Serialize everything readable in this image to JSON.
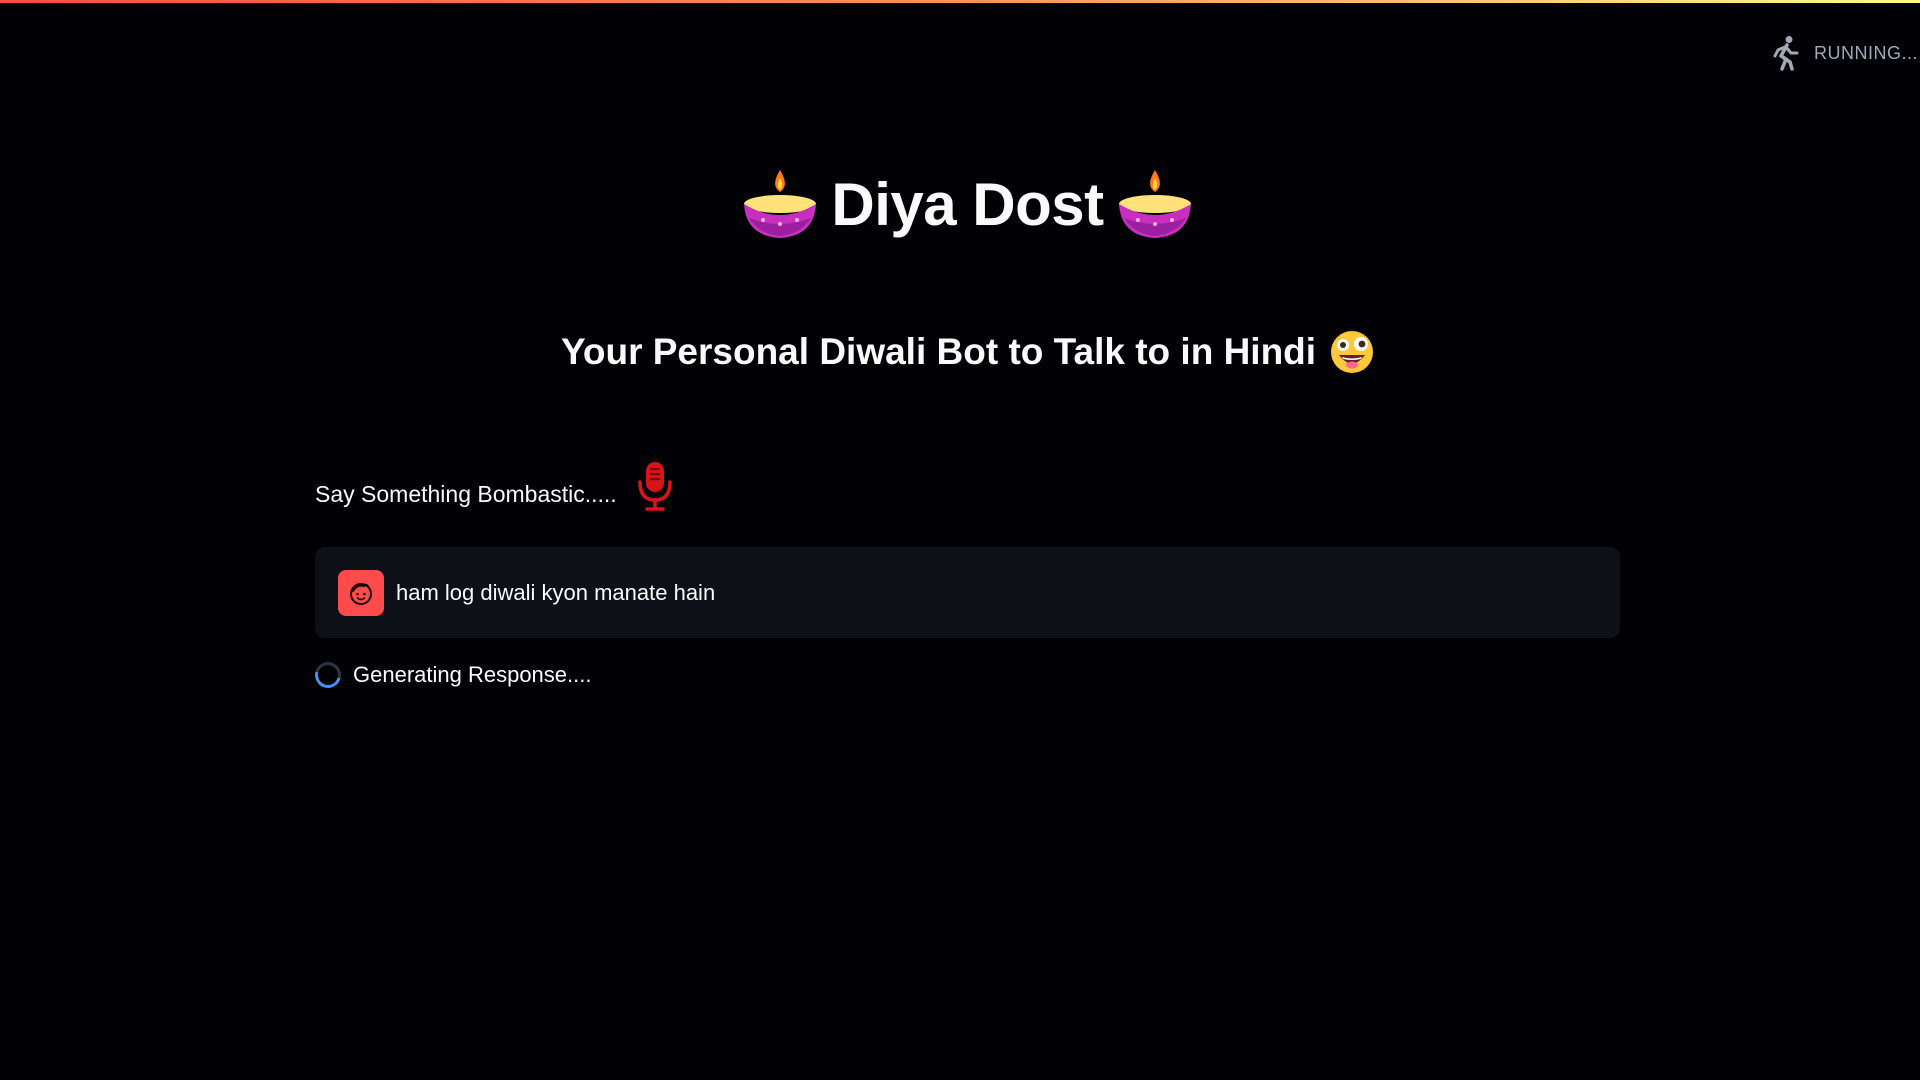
{
  "status": {
    "text": "RUNNING...",
    "icon": "running-man-icon"
  },
  "header": {
    "title": "Diya Dost",
    "title_icon": "diya-lamp-icon",
    "subtitle": "Your Personal Diwali Bot to Talk to in Hindi",
    "subtitle_icon": "grinning-crazy-face-emoji"
  },
  "recorder": {
    "label": "Say Something Bombastic.....",
    "icon": "microphone-icon",
    "icon_color": "#d7141a"
  },
  "chat": {
    "messages": [
      {
        "role": "user",
        "avatar_icon": "user-face-icon",
        "text": "ham log diwali kyon manate hain"
      }
    ]
  },
  "spinner": {
    "text": "Generating Response...."
  },
  "colors": {
    "background": "#020206",
    "accent": "#ff4b4b",
    "message_bg": "#0e1017",
    "spinner": "#4a8ef0"
  }
}
